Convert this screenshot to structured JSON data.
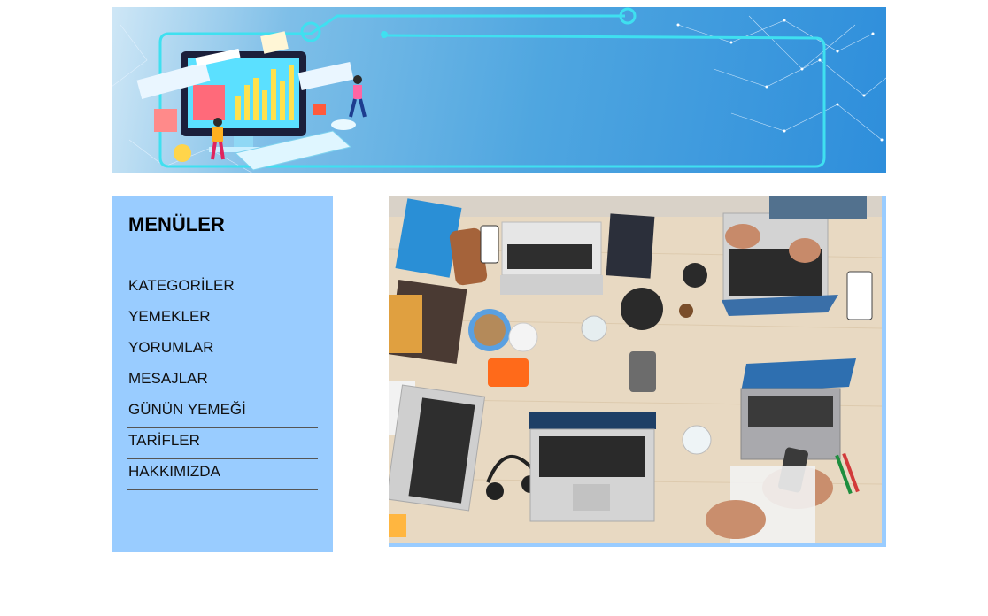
{
  "sidebar": {
    "title": "MENÜLER",
    "items": [
      {
        "label": "KATEGORİLER"
      },
      {
        "label": "YEMEKLER"
      },
      {
        "label": "YORUMLAR"
      },
      {
        "label": "MESAJLAR"
      },
      {
        "label": "GÜNÜN YEMEĞİ"
      },
      {
        "label": "TARİFLER"
      },
      {
        "label": "HAKKIMIZDA"
      }
    ]
  },
  "colors": {
    "sidebar_bg": "#99ccff",
    "banner_start": "#cfe7f6",
    "banner_end": "#2e8edb",
    "table_wood": "#e8d9c2"
  },
  "images": {
    "banner": "data-analytics-illustration",
    "photo": "team-workspace-laptops-top-view"
  }
}
